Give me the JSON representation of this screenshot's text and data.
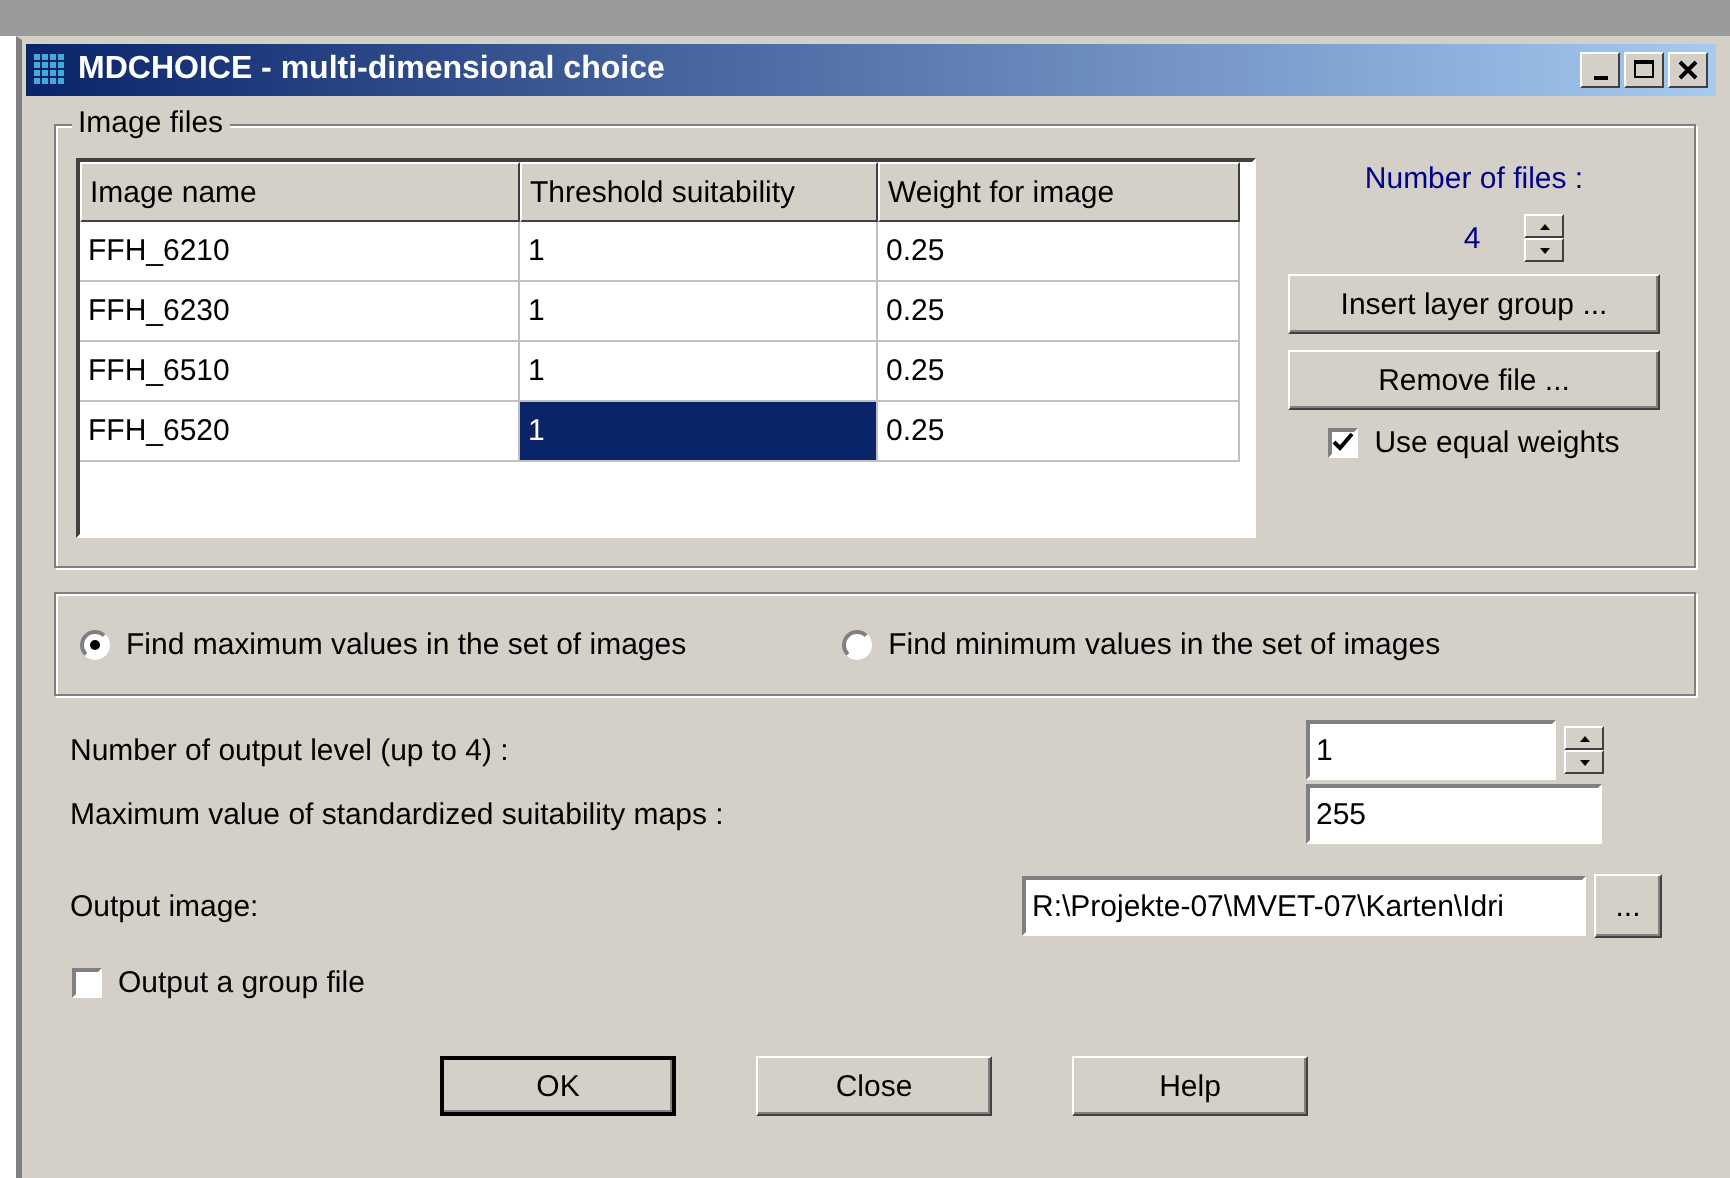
{
  "window": {
    "title": "MDCHOICE - multi-dimensional choice"
  },
  "image_files": {
    "legend": "Image files",
    "columns": [
      "Image name",
      "Threshold suitability",
      "Weight for image"
    ],
    "rows": [
      {
        "cells": [
          {
            "text": "FFH_6210",
            "selected": false
          },
          {
            "text": "1",
            "selected": false
          },
          {
            "text": "0.25",
            "selected": false
          }
        ]
      },
      {
        "cells": [
          {
            "text": "FFH_6230",
            "selected": false
          },
          {
            "text": "1",
            "selected": false
          },
          {
            "text": "0.25",
            "selected": false
          }
        ]
      },
      {
        "cells": [
          {
            "text": "FFH_6510",
            "selected": false
          },
          {
            "text": "1",
            "selected": false
          },
          {
            "text": "0.25",
            "selected": false
          }
        ]
      },
      {
        "cells": [
          {
            "text": "FFH_6520",
            "selected": false
          },
          {
            "text": "1",
            "selected": true
          },
          {
            "text": "0.25",
            "selected": false
          }
        ]
      }
    ],
    "number_label": "Number of files :",
    "number_value": "4",
    "buttons": [
      "Insert layer group ...",
      "Remove file ..."
    ],
    "equal_weights": {
      "label": "Use equal weights",
      "checked": true
    }
  },
  "mode": [
    {
      "label": "Find maximum values in the set of images",
      "selected": true
    },
    {
      "label": "Find minimum values in the set of images",
      "selected": false
    }
  ],
  "output_level": {
    "label": "Number of output level (up to 4) :",
    "value": "1"
  },
  "max_value": {
    "label": "Maximum value of standardized suitability maps :",
    "value": "255"
  },
  "output_image": {
    "label": "Output image:",
    "value": "R:\\Projekte-07\\MVET-07\\Karten\\Idri",
    "browse": "..."
  },
  "group_file": {
    "label": "Output a group file",
    "checked": false
  },
  "buttons": [
    {
      "label": "OK",
      "default": true
    },
    {
      "label": "Close",
      "default": false
    },
    {
      "label": "Help",
      "default": false
    }
  ]
}
